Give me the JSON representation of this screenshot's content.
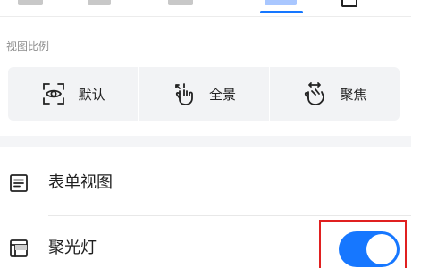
{
  "view_scale": {
    "section_title": "视图比例",
    "options": [
      {
        "label": "默认",
        "icon": "eye-scan-icon"
      },
      {
        "label": "全景",
        "icon": "pinch-out-hand-icon"
      },
      {
        "label": "聚焦",
        "icon": "pinch-in-hand-icon"
      }
    ]
  },
  "settings": {
    "form_view": {
      "label": "表单视图",
      "icon": "list-form-icon"
    },
    "spotlight": {
      "label": "聚光灯",
      "icon": "spotlight-table-icon",
      "enabled": true
    }
  },
  "colors": {
    "accent": "#1677ff",
    "highlight_border": "#e02020",
    "button_bar_bg": "#f2f3f5"
  }
}
